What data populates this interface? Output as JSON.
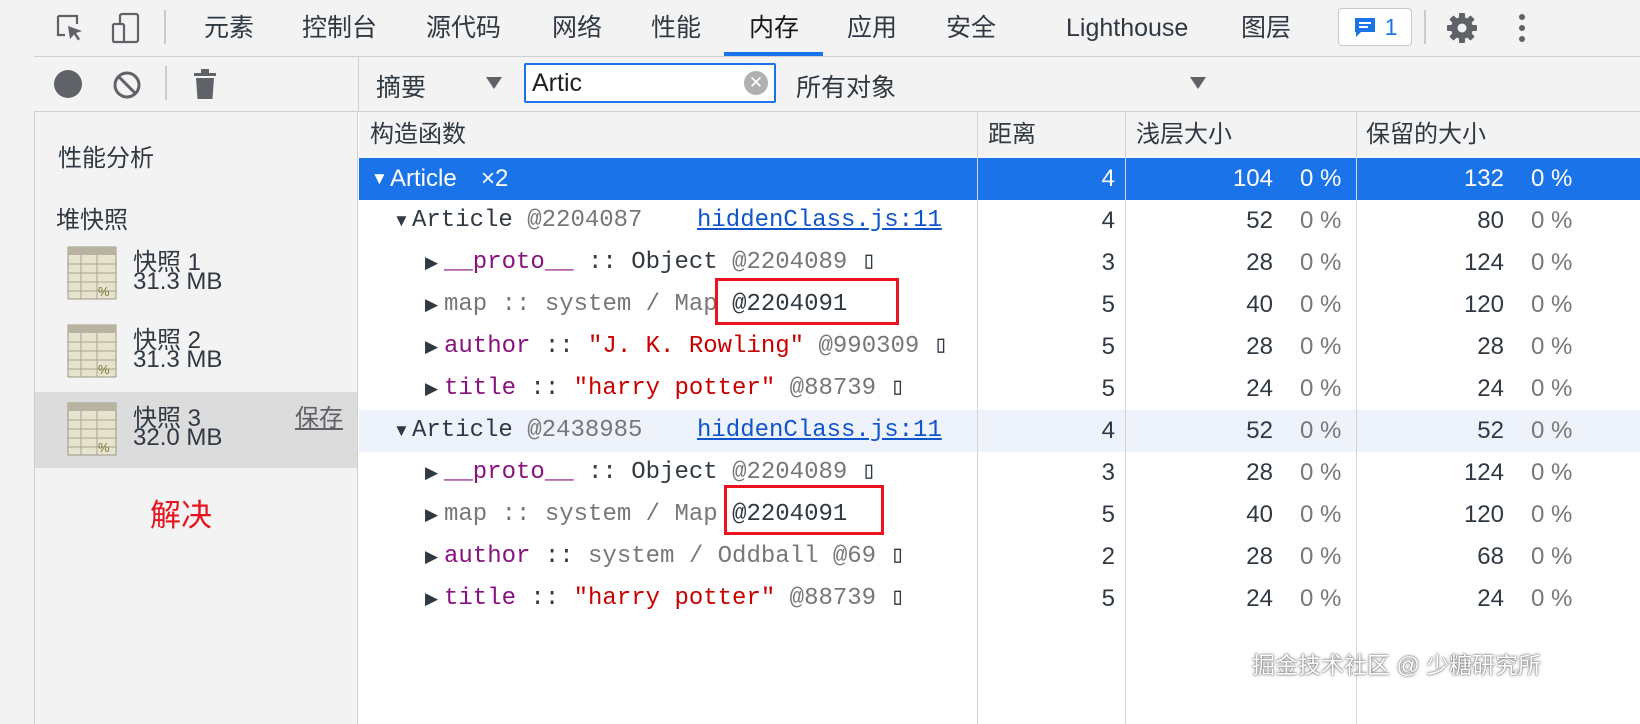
{
  "topbar": {
    "tabs": [
      "元素",
      "控制台",
      "源代码",
      "网络",
      "性能",
      "内存",
      "应用",
      "安全",
      "Lighthouse",
      "图层"
    ],
    "active_tab": "内存",
    "badge_count": "1",
    "accent": "#1a73e8"
  },
  "toolbar": {
    "view_select": "摘要",
    "filter_value": "Artic",
    "scope_select": "所有对象"
  },
  "sidebar": {
    "section_profiles": "性能分析",
    "section_heap": "堆快照",
    "snapshots": [
      {
        "name": "快照 1",
        "size": "31.3 MB"
      },
      {
        "name": "快照 2",
        "size": "31.3 MB"
      },
      {
        "name": "快照 3",
        "size": "32.0 MB",
        "action": "保存"
      }
    ],
    "annotation": "解决",
    "annotation_color": "#e8131e"
  },
  "table": {
    "headers": [
      "构造函数",
      "距离",
      "浅层大小",
      "保留的大小"
    ],
    "group": {
      "name": "Article",
      "count": "×2",
      "distance": "4",
      "shallow": "104",
      "shallow_pct": "0 %",
      "retained": "132",
      "retained_pct": "0 %"
    },
    "rows": [
      {
        "prefix": "Article",
        "addr": "@2204087",
        "link": "hiddenClass.js:11",
        "distance": "4",
        "shallow": "52",
        "shallow_pct": "0 %",
        "retained": "80",
        "retained_pct": "0 %"
      },
      {
        "key": "__proto__",
        "sep": " :: ",
        "val": "Object",
        "addr": "@2204089",
        "tail": "▯",
        "distance": "3",
        "shallow": "28",
        "shallow_pct": "0 %",
        "retained": "124",
        "retained_pct": "0 %"
      },
      {
        "key": "map",
        "sep": " :: ",
        "val": "system / Map",
        "addr": "@2204091",
        "tail": "",
        "distance": "5",
        "shallow": "40",
        "shallow_pct": "0 %",
        "retained": "120",
        "retained_pct": "0 %"
      },
      {
        "key": "author",
        "sep": " :: ",
        "val": "\"J. K. Rowling\"",
        "addr": "@990309",
        "tail": "▯",
        "distance": "5",
        "shallow": "28",
        "shallow_pct": "0 %",
        "retained": "28",
        "retained_pct": "0 %"
      },
      {
        "key": "title",
        "sep": " :: ",
        "val": "\"harry potter\"",
        "addr": "@88739",
        "tail": "▯",
        "distance": "5",
        "shallow": "24",
        "shallow_pct": "0 %",
        "retained": "24",
        "retained_pct": "0 %"
      },
      {
        "prefix": "Article",
        "addr": "@2438985",
        "link": "hiddenClass.js:11",
        "distance": "4",
        "shallow": "52",
        "shallow_pct": "0 %",
        "retained": "52",
        "retained_pct": "0 %"
      },
      {
        "key": "__proto__",
        "sep": " :: ",
        "val": "Object",
        "addr": "@2204089",
        "tail": "▯",
        "distance": "3",
        "shallow": "28",
        "shallow_pct": "0 %",
        "retained": "124",
        "retained_pct": "0 %"
      },
      {
        "key": "map",
        "sep": " :: ",
        "val": "system / Map",
        "addr": "@2204091",
        "tail": "",
        "distance": "5",
        "shallow": "40",
        "shallow_pct": "0 %",
        "retained": "120",
        "retained_pct": "0 %"
      },
      {
        "key": "author",
        "sep": " :: ",
        "val": "system / Oddball",
        "addr": "@69",
        "tail": "▯",
        "distance": "2",
        "shallow": "28",
        "shallow_pct": "0 %",
        "retained": "68",
        "retained_pct": "0 %"
      },
      {
        "key": "title",
        "sep": " :: ",
        "val": "\"harry potter\"",
        "addr": "@88739",
        "tail": "▯",
        "distance": "5",
        "shallow": "24",
        "shallow_pct": "0 %",
        "retained": "24",
        "retained_pct": "0 %"
      }
    ]
  },
  "watermark": "掘金技术社区 @ 少糖研究所"
}
